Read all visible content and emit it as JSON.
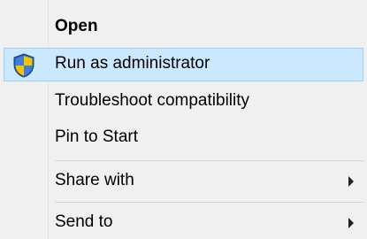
{
  "context_menu": {
    "items": [
      {
        "label": "Open",
        "bold": true
      },
      {
        "label": "Run as administrator",
        "icon": "uac-shield-icon",
        "highlighted": true
      },
      {
        "label": "Troubleshoot compatibility"
      },
      {
        "label": "Pin to Start"
      },
      {
        "label": "Share with",
        "submenu": true
      },
      {
        "label": "Send to",
        "submenu": true
      }
    ]
  },
  "colors": {
    "menu_background": "#f0f0f0",
    "highlight_background": "#cce8ff",
    "highlight_border": "#99d1ff",
    "separator": "#d6d6d6",
    "text": "#000000"
  }
}
